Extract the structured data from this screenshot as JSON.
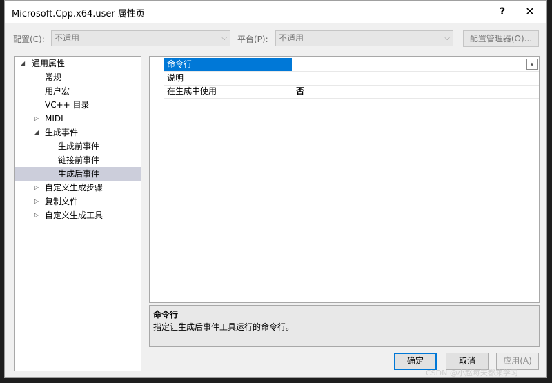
{
  "window": {
    "title": "Microsoft.Cpp.x64.user 属性页",
    "help_glyph": "?",
    "close_glyph": "✕"
  },
  "config_bar": {
    "config_label": "配置(C):",
    "config_value": "不适用",
    "platform_label": "平台(P):",
    "platform_value": "不适用",
    "manager_button": "配置管理器(O)..."
  },
  "tree": {
    "items": [
      {
        "label": "通用属性",
        "expander": "◢",
        "selected": false
      },
      {
        "label": "常规",
        "expander": "",
        "selected": false
      },
      {
        "label": "用户宏",
        "expander": "",
        "selected": false
      },
      {
        "label": "VC++ 目录",
        "expander": "",
        "selected": false
      },
      {
        "label": "MIDL",
        "expander": "▷",
        "selected": false
      },
      {
        "label": "生成事件",
        "expander": "◢",
        "selected": false
      },
      {
        "label": "生成前事件",
        "expander": "",
        "selected": false
      },
      {
        "label": "链接前事件",
        "expander": "",
        "selected": false
      },
      {
        "label": "生成后事件",
        "expander": "",
        "selected": true
      },
      {
        "label": "自定义生成步骤",
        "expander": "▷",
        "selected": false
      },
      {
        "label": "复制文件",
        "expander": "▷",
        "selected": false
      },
      {
        "label": "自定义生成工具",
        "expander": "▷",
        "selected": false
      }
    ]
  },
  "properties": [
    {
      "name": "命令行",
      "value": ""
    },
    {
      "name": "说明",
      "value": ""
    },
    {
      "name": "在生成中使用",
      "value": "否"
    }
  ],
  "description": {
    "title": "命令行",
    "text": "指定让生成后事件工具运行的命令行。"
  },
  "buttons": {
    "ok": "确定",
    "cancel": "取消",
    "apply": "应用(A)"
  },
  "watermark": "CSDN @小赵每天都来学习",
  "colors": {
    "selection_blue": "#0078d7",
    "tree_selection": "#cccedb",
    "dialog_bg": "#f0f0f0"
  }
}
